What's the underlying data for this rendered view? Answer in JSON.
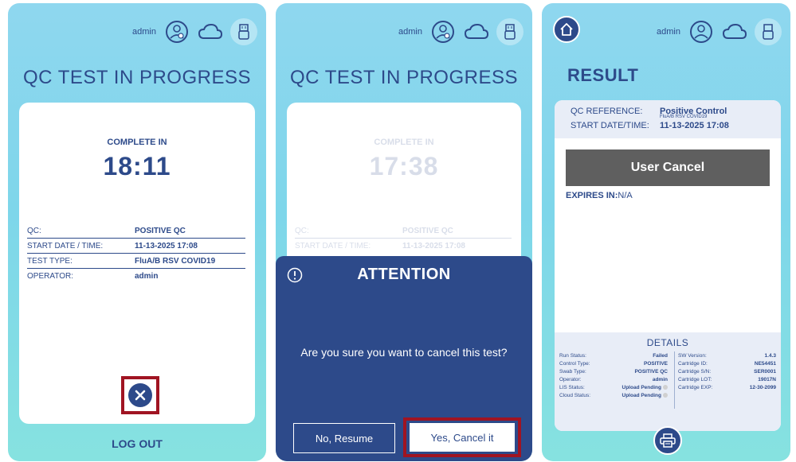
{
  "user": "admin",
  "screen1": {
    "title": "QC TEST IN PROGRESS",
    "complete_label": "COMPLETE IN",
    "timer": "18:11",
    "rows": [
      {
        "key": "QC:",
        "value": "POSITIVE QC"
      },
      {
        "key": "START DATE / TIME:",
        "value": "11-13-2025 17:08"
      },
      {
        "key": "TEST TYPE:",
        "value": "FluA/B RSV COVID19"
      },
      {
        "key": "OPERATOR:",
        "value": "admin"
      }
    ],
    "logout": "LOG OUT"
  },
  "screen2": {
    "title": "QC TEST IN PROGRESS",
    "complete_label": "COMPLETE IN",
    "timer": "17:38",
    "rows": [
      {
        "key": "QC:",
        "value": "POSITIVE QC"
      },
      {
        "key": "START DATE / TIME:",
        "value": "11-13-2025 17:08"
      }
    ],
    "modal": {
      "title": "ATTENTION",
      "message": "Are you sure you want to cancel this test?",
      "resume_label": "No, Resume",
      "cancel_label": "Yes, Cancel it"
    }
  },
  "screen3": {
    "title": "RESULT",
    "qc_reference_label": "QC REFERENCE:",
    "qc_reference_value": "Positive Control",
    "qc_reference_sub": "FluA/B RSV COVID19",
    "start_label": "START DATE/TIME:",
    "start_value": "11-13-2025 17:08",
    "banner": "User Cancel",
    "expires_label": "EXPIRES IN:",
    "expires_value": "N/A",
    "details_title": "DETAILS",
    "details_left": [
      {
        "k": "Run Status:",
        "v": "Failed"
      },
      {
        "k": "Control Type:",
        "v": "POSITIVE"
      },
      {
        "k": "Swab Type:",
        "v": "POSITIVE QC"
      },
      {
        "k": "Operator:",
        "v": "admin"
      },
      {
        "k": "LIS Status:",
        "v": "Upload Pending"
      },
      {
        "k": "Cloud Status:",
        "v": "Upload Pending"
      }
    ],
    "details_right": [
      {
        "k": "SW Version:",
        "v": "1.4.3"
      },
      {
        "k": "Cartridge ID:",
        "v": "NE54451"
      },
      {
        "k": "Cartridge S/N:",
        "v": "SER0001"
      },
      {
        "k": "Cartridge LOT:",
        "v": "19017N"
      },
      {
        "k": "Cartridge EXP:",
        "v": "12-30-2099"
      }
    ]
  },
  "icons": {
    "user": "user-gear-icon",
    "cloud": "cloud-icon",
    "usb": "usb-icon",
    "home": "home-icon",
    "print": "printer-icon",
    "close": "close-icon",
    "alert": "alert-circle-icon"
  },
  "colors": {
    "primary": "#2d4a8a",
    "highlight": "#a01422",
    "banner": "#5f5f5f"
  }
}
